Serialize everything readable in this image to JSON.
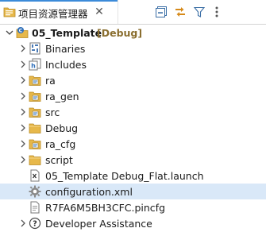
{
  "tab": {
    "title": "项目资源管理器",
    "close_glyph": "✕"
  },
  "toolbar": {
    "buttons": [
      {
        "name": "collapse-all-icon"
      },
      {
        "name": "link-with-editor-icon"
      },
      {
        "name": "filter-icon"
      },
      {
        "name": "view-menu-icon"
      }
    ]
  },
  "tree": {
    "project": {
      "name": "05_Template",
      "decoration": "[Debug]",
      "expanded": true
    },
    "children": [
      {
        "label": "Binaries",
        "icon": "binaries-icon",
        "expandable": true
      },
      {
        "label": "Includes",
        "icon": "includes-icon",
        "expandable": true
      },
      {
        "label": "ra",
        "icon": "source-folder-icon",
        "expandable": true
      },
      {
        "label": "ra_gen",
        "icon": "source-folder-icon",
        "expandable": true
      },
      {
        "label": "src",
        "icon": "source-folder-icon",
        "expandable": true
      },
      {
        "label": "Debug",
        "icon": "folder-icon",
        "expandable": true
      },
      {
        "label": "ra_cfg",
        "icon": "source-folder-icon",
        "expandable": true
      },
      {
        "label": "script",
        "icon": "folder-icon",
        "expandable": true
      },
      {
        "label": "05_Template Debug_Flat.launch",
        "icon": "launch-file-icon",
        "expandable": false
      },
      {
        "label": "configuration.xml",
        "icon": "configuration-gear-icon",
        "expandable": false,
        "selected": true
      },
      {
        "label": "R7FA6M5BH3CFC.pincfg",
        "icon": "file-icon",
        "expandable": false
      },
      {
        "label": "Developer Assistance",
        "icon": "developer-assistance-icon",
        "expandable": true
      }
    ]
  },
  "colors": {
    "accent": "#3c8bd9",
    "selection": "#d9e8f8",
    "folder": "#e7b84a",
    "decoration": "#8a6e2f"
  }
}
